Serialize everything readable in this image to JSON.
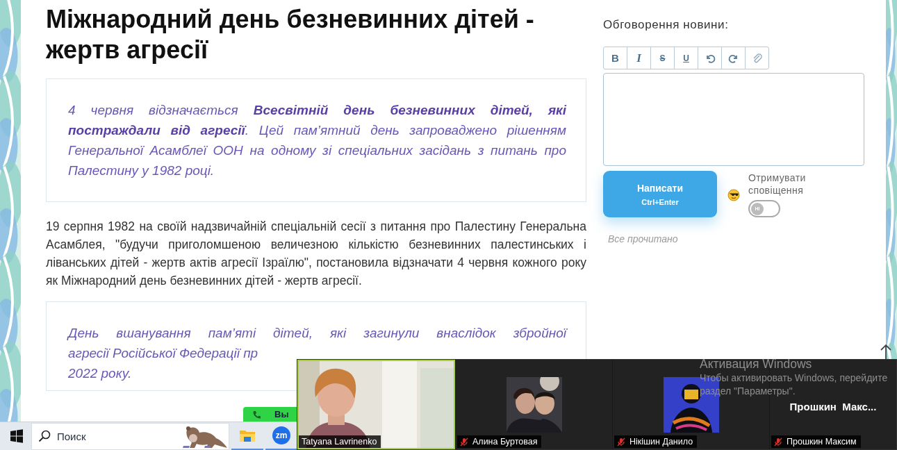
{
  "article": {
    "title": "Міжнародний день безневинних дітей - жертв агресії",
    "quote": "4 червня відзначається **Всесвітній день безневинних дітей, які постраждали від агресії**. Цей пам’ятний день запроваджено рішенням Генеральної Асамблеї ООН на одному зі спеціальних засідань з питань про Палестину у 1982 році.",
    "paragraph": "19 серпня 1982 на своїй надзвичайній спеціальній сесії з питання про Палестину Генеральна Асамблея, \"будучи приголомшеною величезною кількістю безневинних палестинських і ліванських дітей - жертв актів агресії Ізраїлю\", постановила відзначати 4 червня кожного року як Міжнародний день безневинних дітей - жертв агресії.",
    "quote_2_lines": [
      "День вшанування пам’яті дітей, які загинули внаслідок збройної",
      "агресії Російської Федерації пр",
      "2022 року."
    ]
  },
  "discussion": {
    "heading": "Обговорення новини:",
    "tools": [
      {
        "kind": "bold",
        "label": "B"
      },
      {
        "kind": "italic",
        "label": "I"
      },
      {
        "kind": "strike",
        "label": "S"
      },
      {
        "kind": "underline",
        "label": "U"
      },
      {
        "kind": "undo"
      },
      {
        "kind": "redo"
      },
      {
        "kind": "attach"
      }
    ],
    "submit": {
      "label": "Написати",
      "shortcut": "Ctrl+Enter"
    },
    "notify": {
      "label": "Отримувати сповіщення",
      "on": false,
      "toggle_text": "НІ"
    },
    "status": "Все прочитано"
  },
  "call_button": {
    "label": "Вы"
  },
  "taskbar": {
    "search": {
      "placeholder": "Поиск"
    },
    "apps": [
      {
        "kind": "explorer",
        "active": true
      },
      {
        "kind": "zoom",
        "label": "zm",
        "active": true
      }
    ]
  },
  "meeting": {
    "tiles": [
      {
        "kind": "video",
        "name": "Tatyana Lavrinenko",
        "speaking": true,
        "muted": false
      },
      {
        "kind": "avatar",
        "name": "Алина Буртовая",
        "speaking": false,
        "muted": true
      },
      {
        "kind": "avatar",
        "name": "Нікішин Данило",
        "speaking": false,
        "muted": true
      },
      {
        "kind": "name",
        "display": "Прошкин  Макс...",
        "name": "Прошкин Максим",
        "speaking": false,
        "muted": true
      }
    ]
  },
  "windows_notice": {
    "title": "Активация Windows",
    "lines": [
      "Чтобы активировать Windows, перейдите",
      "раздел \"Параметры\"."
    ]
  }
}
